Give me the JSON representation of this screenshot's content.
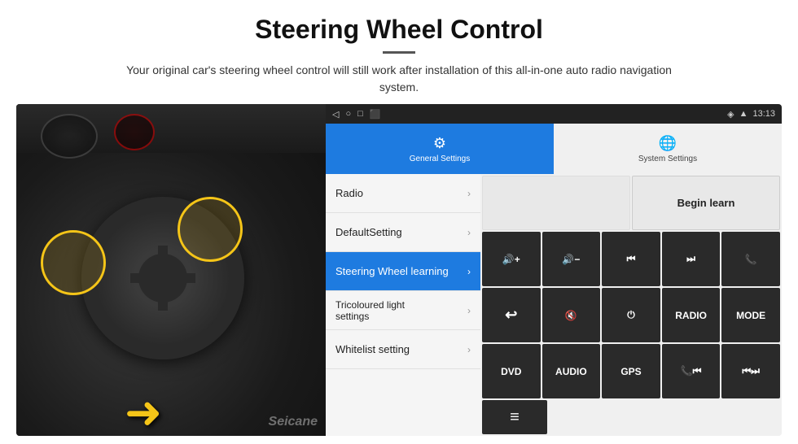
{
  "header": {
    "title": "Steering Wheel Control",
    "subtitle": "Your original car's steering wheel control will still work after installation of this all-in-one auto radio navigation system."
  },
  "statusbar": {
    "time": "13:13",
    "icons": [
      "◁",
      "○",
      "□",
      "⬛"
    ]
  },
  "tabs": [
    {
      "id": "general",
      "label": "General Settings",
      "icon": "⚙",
      "active": true
    },
    {
      "id": "system",
      "label": "System Settings",
      "icon": "🌐",
      "active": false
    }
  ],
  "menu": {
    "items": [
      {
        "label": "Radio",
        "active": false
      },
      {
        "label": "DefaultSetting",
        "active": false
      },
      {
        "label": "Steering Wheel learning",
        "active": true
      },
      {
        "label": "Tricoloured light settings",
        "active": false
      },
      {
        "label": "Whitelist setting",
        "active": false
      }
    ]
  },
  "controls": {
    "row1": [
      {
        "label": "",
        "type": "empty"
      },
      {
        "label": "Begin learn",
        "type": "begin-learn"
      }
    ],
    "row2": [
      {
        "label": "🔊+",
        "type": "dark"
      },
      {
        "label": "🔊-",
        "type": "dark"
      },
      {
        "label": "⏮",
        "type": "dark"
      },
      {
        "label": "⏭",
        "type": "dark"
      },
      {
        "label": "📞",
        "type": "dark"
      }
    ],
    "row3": [
      {
        "label": "↩",
        "type": "dark"
      },
      {
        "label": "🔇",
        "type": "dark"
      },
      {
        "label": "⏻",
        "type": "dark"
      },
      {
        "label": "RADIO",
        "type": "dark"
      },
      {
        "label": "MODE",
        "type": "dark"
      }
    ],
    "row4": [
      {
        "label": "DVD",
        "type": "dark"
      },
      {
        "label": "AUDIO",
        "type": "dark"
      },
      {
        "label": "GPS",
        "type": "dark"
      },
      {
        "label": "📞⏮",
        "type": "dark"
      },
      {
        "label": "⏮⏭",
        "type": "dark"
      }
    ],
    "row5": [
      {
        "label": "≡",
        "type": "dark"
      }
    ]
  },
  "watermark": "Seicane"
}
